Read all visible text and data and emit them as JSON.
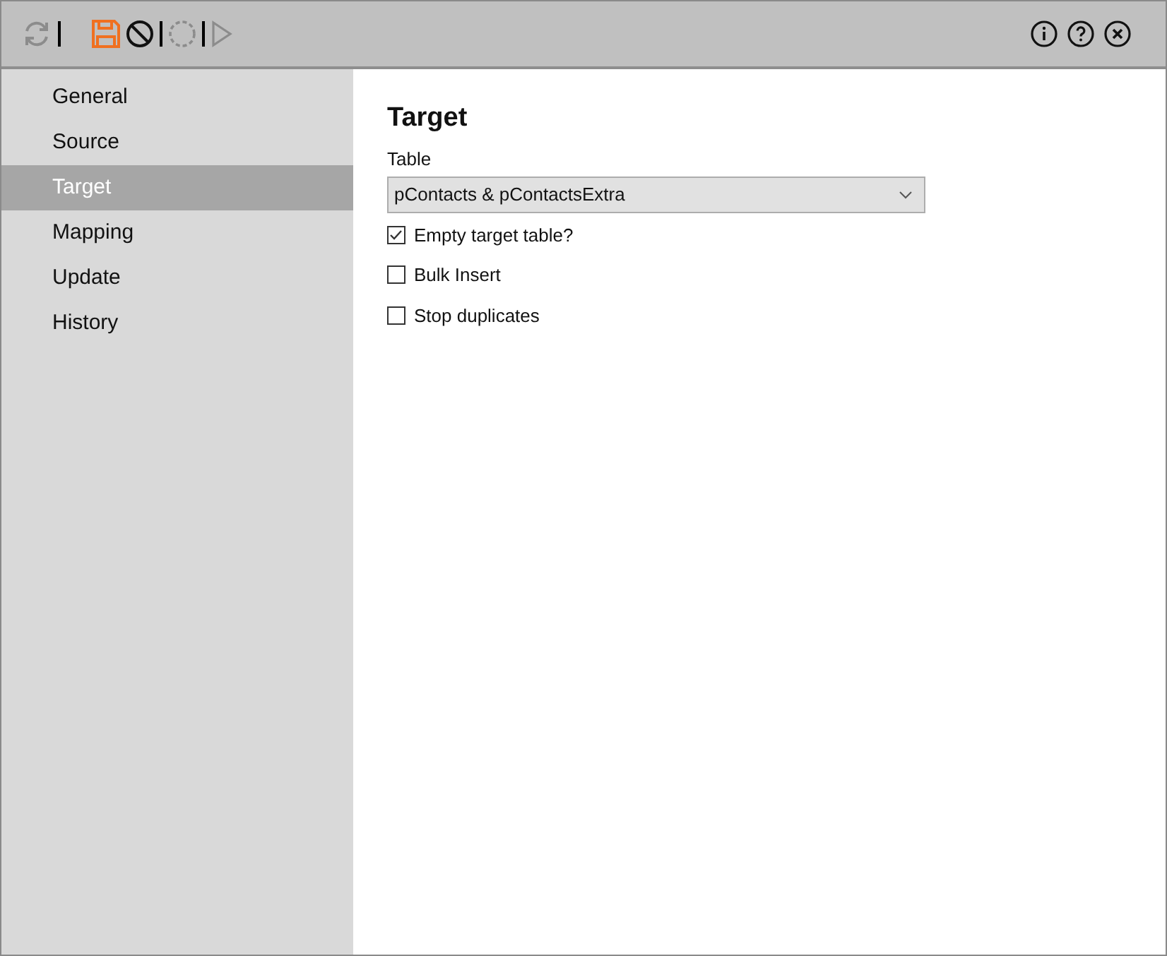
{
  "toolbar": {
    "buttons": [
      {
        "disabled": true
      },
      {
        "disabled": false,
        "highlighted": true
      },
      {
        "disabled": false,
        "highlighted": false
      },
      {
        "disabled": true
      },
      {
        "disabled": true
      }
    ]
  },
  "sidebar": {
    "items": [
      {
        "label": "General",
        "selected": false
      },
      {
        "label": "Source",
        "selected": false
      },
      {
        "label": "Target",
        "selected": true
      },
      {
        "label": "Mapping",
        "selected": false
      },
      {
        "label": "Update",
        "selected": false
      },
      {
        "label": "History",
        "selected": false
      }
    ]
  },
  "content": {
    "title": "Target",
    "table_label": "Table",
    "table_value": "pContacts & pContactsExtra",
    "options": [
      {
        "label": "Empty target table?",
        "checked": true
      },
      {
        "label": "Bulk Insert",
        "checked": false
      },
      {
        "label": "Stop duplicates",
        "checked": false
      }
    ]
  }
}
